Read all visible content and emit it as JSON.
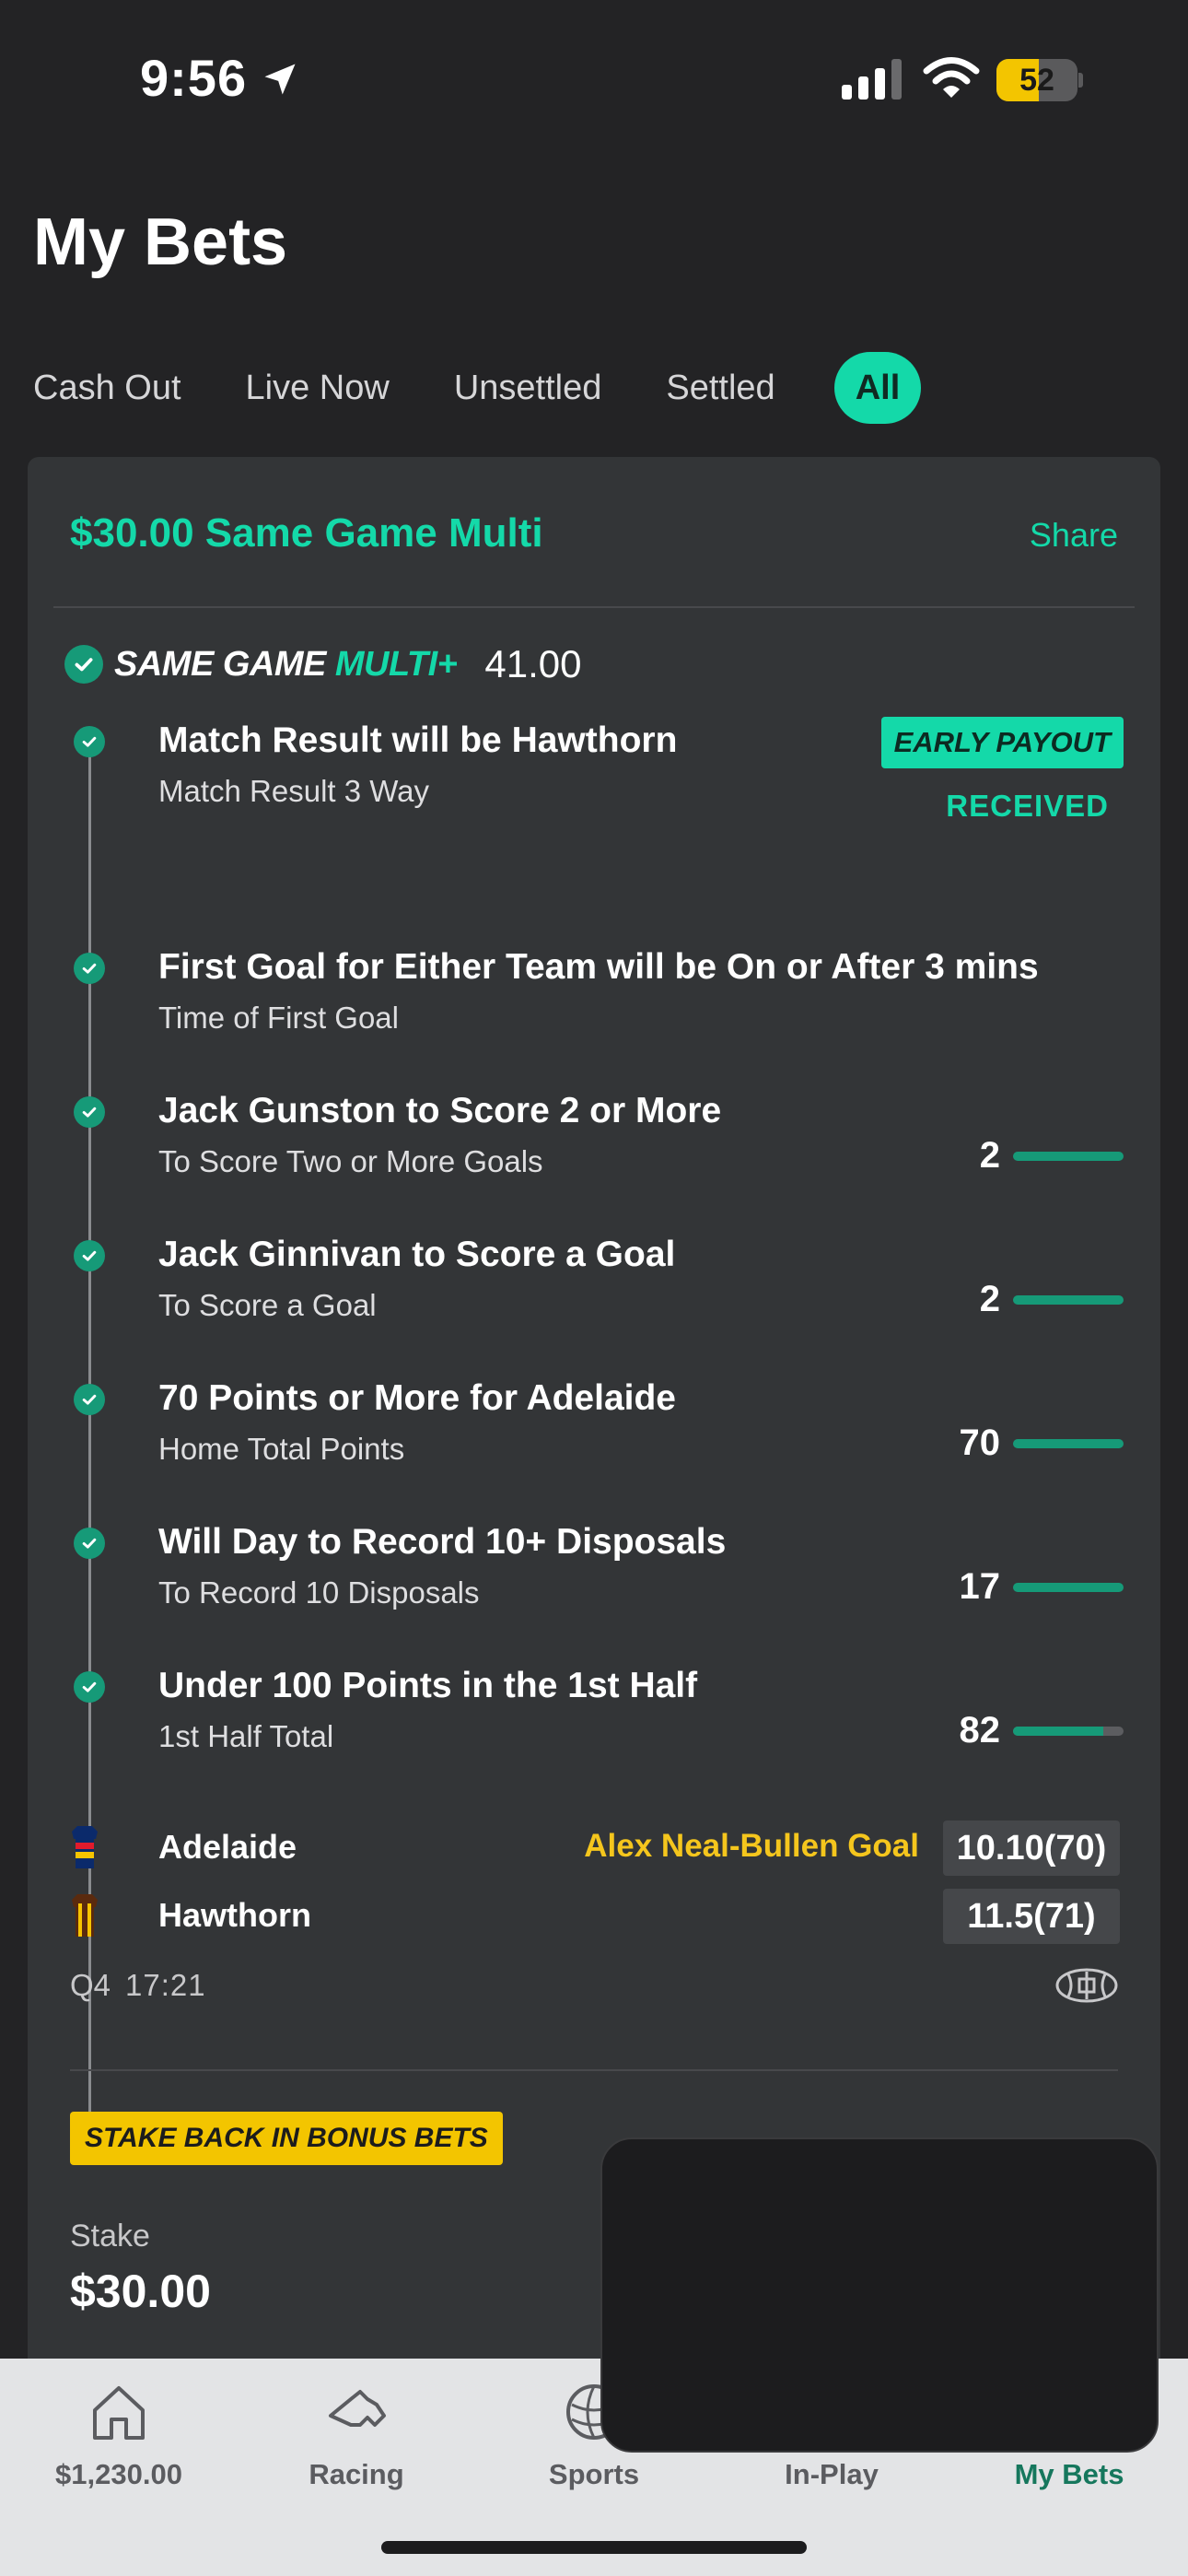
{
  "status_bar": {
    "time": "9:56",
    "battery": "52",
    "battery_level": 0.52
  },
  "page": {
    "title": "My Bets"
  },
  "filter_tabs": [
    {
      "label": "Cash Out",
      "active": false
    },
    {
      "label": "Live Now",
      "active": false
    },
    {
      "label": "Unsettled",
      "active": false
    },
    {
      "label": "Settled",
      "active": false
    },
    {
      "label": "All",
      "active": true
    }
  ],
  "bet": {
    "title": "$30.00 Same Game Multi",
    "share_label": "Share",
    "brand_part1": "SAME GAME ",
    "brand_part2": "MULTI+",
    "odds": "41.00",
    "legs": [
      {
        "title": "Match Result will be Hawthorn",
        "subtitle": "Match Result 3 Way",
        "early_payout": "EARLY PAYOUT",
        "received": "RECEIVED"
      },
      {
        "title": "First Goal for Either Team will be On or After 3 mins",
        "subtitle": "Time of First Goal"
      },
      {
        "title": "Jack Gunston to Score 2 or More",
        "subtitle": "To Score Two or More Goals",
        "value": "2",
        "progress": 1.0
      },
      {
        "title": "Jack Ginnivan to Score a Goal",
        "subtitle": "To Score a Goal",
        "value": "2",
        "progress": 1.0
      },
      {
        "title": "70 Points or More for Adelaide",
        "subtitle": "Home Total Points",
        "value": "70",
        "progress": 1.0
      },
      {
        "title": "Will Day to Record 10+ Disposals",
        "subtitle": "To Record 10 Disposals",
        "value": "17",
        "progress": 1.0
      },
      {
        "title": "Under 100 Points in the 1st Half",
        "subtitle": "1st Half Total",
        "value": "82",
        "progress": 0.82
      }
    ],
    "scoreboard": {
      "home": {
        "team": "Adelaide",
        "score": "10.10(70)",
        "event": "Alex Neal-Bullen Goal"
      },
      "away": {
        "team": "Hawthorn",
        "score": "11.5(71)"
      },
      "quarter": "Q4",
      "clock": "17:21"
    },
    "bonus_badge": "STAKE BACK IN BONUS BETS",
    "stake_label": "Stake",
    "stake_value": "$30.00"
  },
  "tabbar": [
    {
      "label": "$1,230.00",
      "icon": "home-icon",
      "active": false
    },
    {
      "label": "Racing",
      "icon": "horse-icon",
      "active": false
    },
    {
      "label": "Sports",
      "icon": "ball-icon",
      "active": false
    },
    {
      "label": "In-Play",
      "icon": "in-play-icon",
      "active": false
    },
    {
      "label": "My Bets",
      "icon": "my-bets-icon",
      "active": true
    }
  ],
  "colors": {
    "accent": "#14d9a9",
    "check": "#169a78",
    "warning": "#f3c500",
    "background": "#232325",
    "card": "#333537"
  }
}
